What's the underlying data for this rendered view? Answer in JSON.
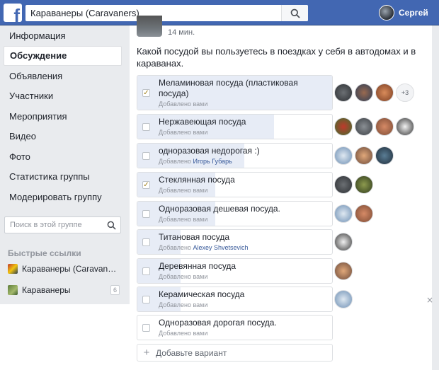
{
  "topbar": {
    "logo_letter": "f",
    "search_value": "Караванеры (Caravaners)",
    "user_name": "Сергей"
  },
  "sidebar": {
    "items": [
      {
        "label": "Информация"
      },
      {
        "label": "Обсуждение"
      },
      {
        "label": "Объявления"
      },
      {
        "label": "Участники"
      },
      {
        "label": "Мероприятия"
      },
      {
        "label": "Видео"
      },
      {
        "label": "Фото"
      },
      {
        "label": "Статистика группы"
      },
      {
        "label": "Модерировать группу"
      }
    ],
    "search_placeholder": "Поиск в этой группе",
    "quick_links_title": "Быстрые ссылки",
    "quick_links": [
      {
        "label": "Караванеры (Caravaners)",
        "count": ""
      },
      {
        "label": "Караванеры",
        "count": "6"
      }
    ]
  },
  "post": {
    "time": "14 мин.",
    "question": "Какой посудой вы пользуетесь в поездках у себя в автодомах и в караванах.",
    "options": [
      {
        "text": "Меламиновая посуда (пластиковая посуда)",
        "added": "Добавлено вами",
        "by": "",
        "checked": true,
        "more": "+3"
      },
      {
        "text": "Нержавеющая посуда",
        "added": "Добавлено вами",
        "by": "",
        "checked": false,
        "more": ""
      },
      {
        "text": "одноразовая недорогая :)",
        "added": "Добавлено",
        "by": "Игорь Губарь",
        "checked": false,
        "more": ""
      },
      {
        "text": "Стеклянная посуда",
        "added": "Добавлено вами",
        "by": "",
        "checked": true,
        "more": ""
      },
      {
        "text": "Одноразовая дешевая посуда.",
        "added": "Добавлено вами",
        "by": "",
        "checked": false,
        "more": ""
      },
      {
        "text": "Титановая посуда",
        "added": "Добавлено",
        "by": "Alexey Shvetsevich",
        "checked": false,
        "more": ""
      },
      {
        "text": "Деревянная посуда",
        "added": "Добавлено вами",
        "by": "",
        "checked": false,
        "more": ""
      },
      {
        "text": "Керамическая посуда",
        "added": "Добавлено вами",
        "by": "",
        "checked": false,
        "more": ""
      },
      {
        "text": "Одноразовая дорогая посуда.",
        "added": "Добавлено вами",
        "by": "",
        "checked": false,
        "more": ""
      }
    ],
    "add_option": "Добавьте вариант",
    "close_glyph": "×"
  },
  "colors": {
    "brand": "#4267b2",
    "bar_fill": "#e7ecf6",
    "link": "#365899"
  }
}
